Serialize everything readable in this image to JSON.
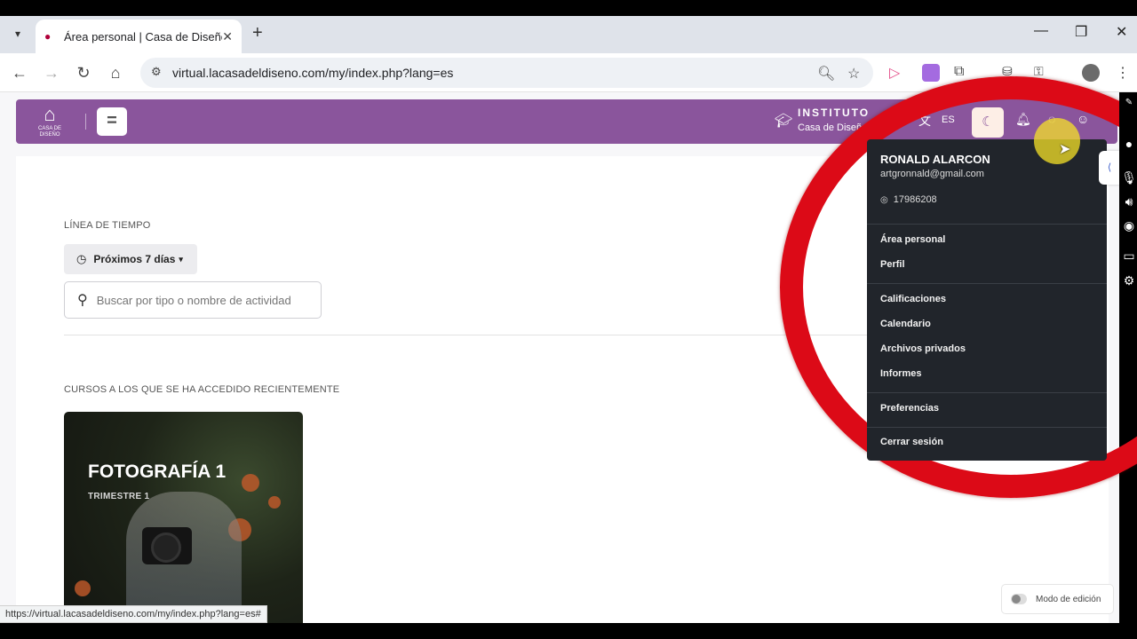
{
  "browser": {
    "tab_title": "Área personal | Casa de Diseño",
    "url": "virtual.lacasadeldiseno.com/my/index.php?lang=es",
    "status_url": "https://virtual.lacasadeldiseno.com/my/index.php?lang=es#"
  },
  "header": {
    "logo_text": "CASA DE DISEÑO",
    "institute_line1": "INSTITUTO",
    "institute_line2": "Casa de Diseño",
    "lang": "ES"
  },
  "timeline": {
    "heading": "LÍNEA DE TIEMPO",
    "filter_label": "Próximos 7 días",
    "search_placeholder": "Buscar por tipo o nombre de actividad"
  },
  "recent": {
    "heading": "CURSOS A LOS QUE SE HA ACCEDIDO RECIENTEMENTE",
    "course_title": "FOTOGRAFÍA 1",
    "course_sub": "TRIMESTRE 1"
  },
  "user_menu": {
    "name": "RONALD ALARCON",
    "email": "artgronnald@gmail.com",
    "id": "17986208",
    "items": [
      "Área personal",
      "Perfil",
      "Calificaciones",
      "Calendario",
      "Archivos privados",
      "Informes",
      "Preferencias",
      "Cerrar sesión"
    ]
  },
  "edit_mode_label": "Modo de edición",
  "colors": {
    "header_purple": "#8a559c",
    "dropdown_dark": "#21252b",
    "annotation_red": "#dc0a17"
  }
}
